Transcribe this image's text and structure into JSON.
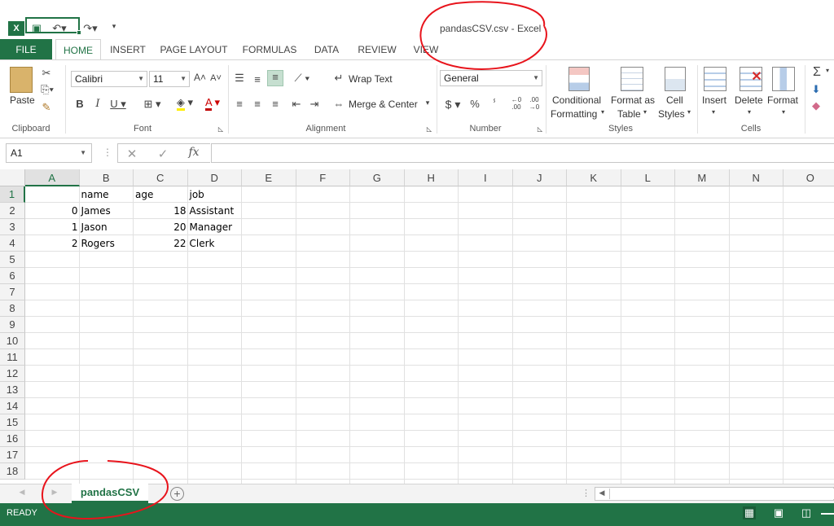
{
  "window": {
    "title": "pandasCSV.csv - Excel"
  },
  "tabs": [
    "FILE",
    "HOME",
    "INSERT",
    "PAGE LAYOUT",
    "FORMULAS",
    "DATA",
    "REVIEW",
    "VIEW"
  ],
  "ribbon": {
    "clipboard": {
      "paste": "Paste",
      "label": "Clipboard"
    },
    "font": {
      "name": "Calibri",
      "size": "11",
      "label": "Font"
    },
    "alignment": {
      "wrap": "Wrap Text",
      "merge": "Merge & Center",
      "label": "Alignment"
    },
    "number": {
      "format": "General",
      "label": "Number"
    },
    "styles": {
      "conditional1": "Conditional",
      "conditional2": "Formatting",
      "format1": "Format as",
      "format2": "Table",
      "cell1": "Cell",
      "cell2": "Styles",
      "label": "Styles"
    },
    "cells": {
      "insert": "Insert",
      "delete": "Delete",
      "format": "Format",
      "label": "Cells"
    }
  },
  "formula_bar": {
    "name_box": "A1",
    "fx": "fx"
  },
  "columns": [
    "A",
    "B",
    "C",
    "D",
    "E",
    "F",
    "G",
    "H",
    "I",
    "J",
    "K",
    "L",
    "M",
    "N",
    "O"
  ],
  "rows": [
    "1",
    "2",
    "3",
    "4",
    "5",
    "6",
    "7",
    "8",
    "9",
    "10",
    "11",
    "12",
    "13",
    "14",
    "15",
    "16",
    "17",
    "18"
  ],
  "cells": {
    "r1": [
      "",
      "name",
      "age",
      "job"
    ],
    "r2": [
      "0",
      "James",
      "18",
      "Assistant"
    ],
    "r3": [
      "1",
      "Jason",
      "20",
      "Manager"
    ],
    "r4": [
      "2",
      "Rogers",
      "22",
      "Clerk"
    ]
  },
  "sheet": {
    "name": "pandasCSV",
    "add": "+"
  },
  "status": {
    "text": "READY"
  },
  "colors": {
    "accent": "#217346",
    "annotation": "#e8141c"
  }
}
